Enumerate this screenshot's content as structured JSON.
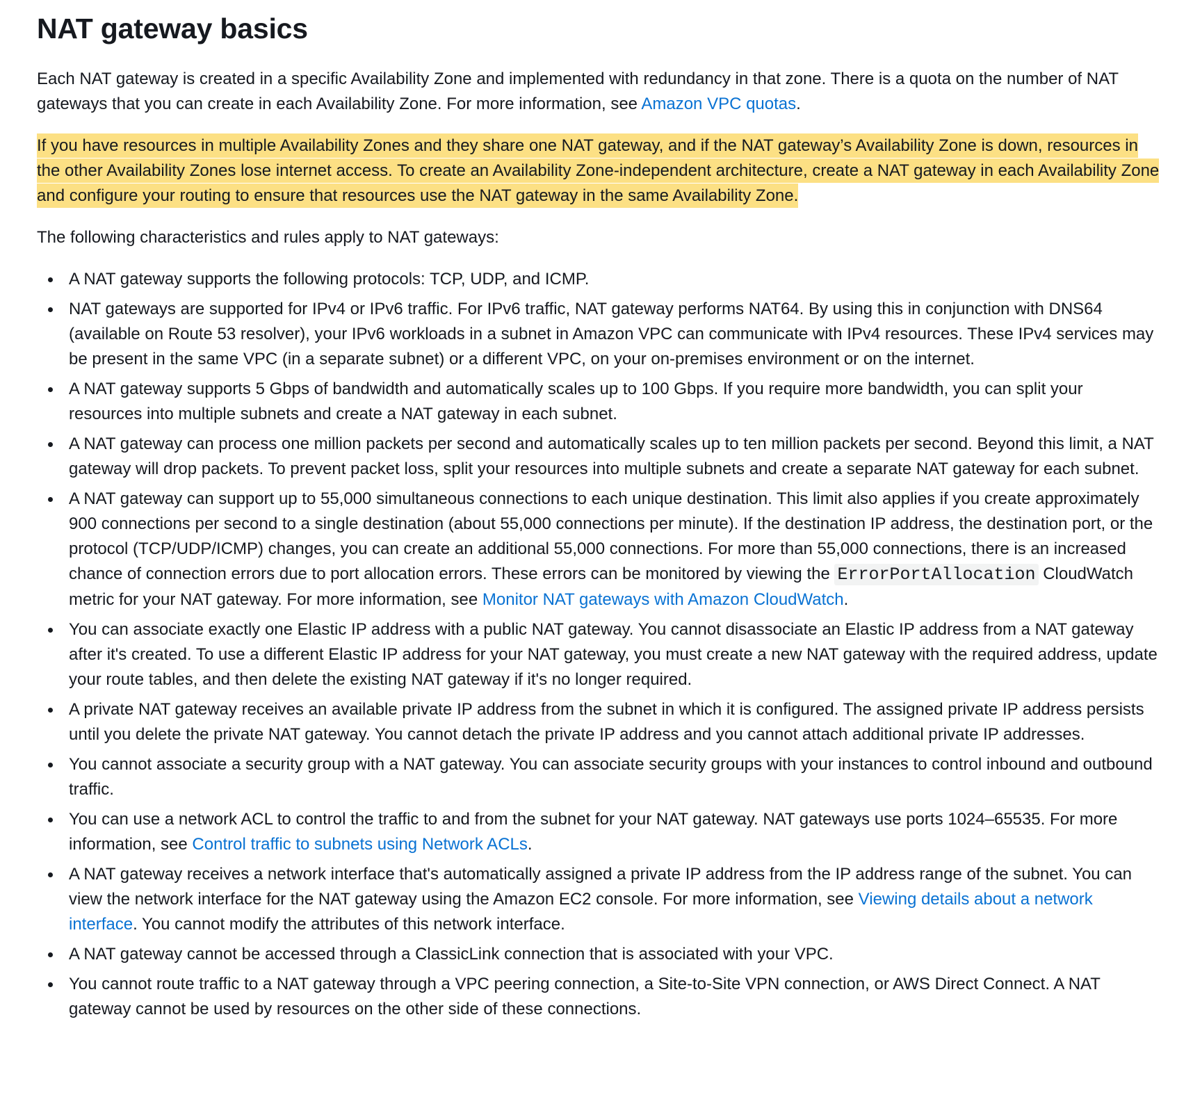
{
  "title": "NAT gateway basics",
  "intro": {
    "text": "Each NAT gateway is created in a specific Availability Zone and implemented with redundancy in that zone. There is a quota on the number of NAT gateways that you can create in each Availability Zone. For more information, see ",
    "link": "Amazon VPC quotas",
    "after": "."
  },
  "highlight_text": "If you have resources in multiple Availability Zones and they share one NAT gateway, and if the NAT gateway’s Availability Zone is down, resources in the other Availability Zones lose internet access. To create an Availability Zone-independent architecture, create a NAT gateway in each Availability Zone and configure your routing to ensure that resources use the NAT gateway in the same Availability Zone.",
  "rules_intro": "The following characteristics and rules apply to NAT gateways:",
  "items": [
    {
      "text": "A NAT gateway supports the following protocols: TCP, UDP, and ICMP."
    },
    {
      "text": "NAT gateways are supported for IPv4 or IPv6 traffic. For IPv6 traffic, NAT gateway performs NAT64. By using this in conjunction with DNS64 (available on Route 53 resolver), your IPv6 workloads in a subnet in Amazon VPC can communicate with IPv4 resources. These IPv4 services may be present in the same VPC (in a separate subnet) or a different VPC, on your on-premises environment or on the internet."
    },
    {
      "text": "A NAT gateway supports 5 Gbps of bandwidth and automatically scales up to 100 Gbps. If you require more bandwidth, you can split your resources into multiple subnets and create a NAT gateway in each subnet."
    },
    {
      "text": "A NAT gateway can process one million packets per second and automatically scales up to ten million packets per second. Beyond this limit, a NAT gateway will drop packets. To prevent packet loss, split your resources into multiple subnets and create a separate NAT gateway for each subnet."
    },
    {
      "text": "A NAT gateway can support up to 55,000 simultaneous connections to each unique destination. This limit also applies if you create approximately 900 connections per second to a single destination (about 55,000 connections per minute). If the destination IP address, the destination port, or the protocol (TCP/UDP/ICMP) changes, you can create an additional 55,000 connections. For more than 55,000 connections, there is an increased chance of connection errors due to port allocation errors. These errors can be monitored by viewing the ",
      "code": "ErrorPortAllocation",
      "text2": " CloudWatch metric for your NAT gateway. For more information, see ",
      "link": "Monitor NAT gateways with Amazon CloudWatch",
      "after": "."
    },
    {
      "text": "You can associate exactly one Elastic IP address with a public NAT gateway. You cannot disassociate an Elastic IP address from a NAT gateway after it's created. To use a different Elastic IP address for your NAT gateway, you must create a new NAT gateway with the required address, update your route tables, and then delete the existing NAT gateway if it's no longer required."
    },
    {
      "text": "A private NAT gateway receives an available private IP address from the subnet in which it is configured. The assigned private IP address persists until you delete the private NAT gateway. You cannot detach the private IP address and you cannot attach additional private IP addresses."
    },
    {
      "text": "You cannot associate a security group with a NAT gateway. You can associate security groups with your instances to control inbound and outbound traffic."
    },
    {
      "text": "You can use a network ACL to control the traffic to and from the subnet for your NAT gateway. NAT gateways use ports 1024–65535. For more information, see ",
      "link": "Control traffic to subnets using Network ACLs",
      "after": "."
    },
    {
      "text": "A NAT gateway receives a network interface that's automatically assigned a private IP address from the IP address range of the subnet. You can view the network interface for the NAT gateway using the Amazon EC2 console. For more information, see ",
      "link": "Viewing details about a network interface",
      "after": ". You cannot modify the attributes of this network interface."
    },
    {
      "text": "A NAT gateway cannot be accessed through a ClassicLink connection that is associated with your VPC."
    },
    {
      "text": "You cannot route traffic to a NAT gateway through a VPC peering connection, a Site-to-Site VPN connection, or AWS Direct Connect. A NAT gateway cannot be used by resources on the other side of these connections."
    }
  ],
  "colors": {
    "text": "#16191f",
    "link": "#0972d3",
    "highlight": "#fce084",
    "code_bg": "#f2f3f3"
  }
}
